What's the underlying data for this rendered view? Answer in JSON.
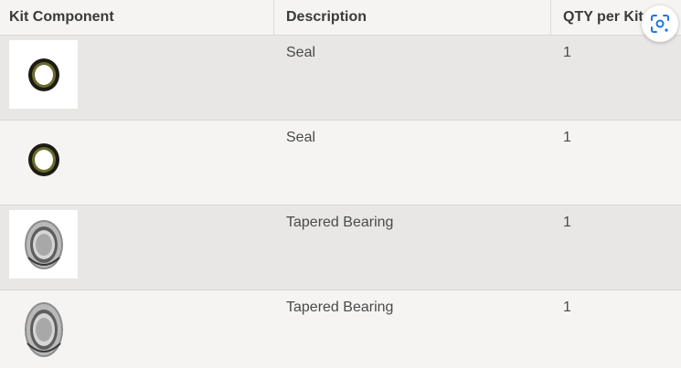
{
  "table": {
    "headers": [
      "Kit Component",
      "Description",
      "QTY per Kit"
    ],
    "rows": [
      {
        "component_icon": "seal-ring-icon",
        "description": "Seal",
        "qty": "1"
      },
      {
        "component_icon": "seal-ring-icon",
        "description": "Seal",
        "qty": "1"
      },
      {
        "component_icon": "tapered-bearing-icon",
        "description": "Tapered Bearing",
        "qty": "1"
      },
      {
        "component_icon": "tapered-bearing-icon",
        "description": "Tapered Bearing",
        "qty": "1"
      }
    ]
  },
  "overlay": {
    "lens_icon": "visual-search-icon",
    "accent_color": "#1a73e8"
  },
  "colors": {
    "header_bg": "#f5f4f3",
    "row_shaded": "#e8e7e6",
    "row_light": "#f5f4f3",
    "text": "#4a4a4a"
  }
}
